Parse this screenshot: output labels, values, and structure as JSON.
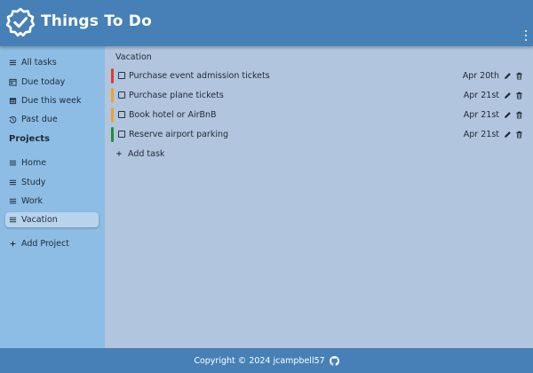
{
  "app": {
    "title": "Things To Do"
  },
  "colors": {
    "header": "#4680b7",
    "sidebar": "#8dbde5",
    "main": "#b1c5de",
    "active_item": "#b8d4ed",
    "priority_high": "#e23b2e",
    "priority_medium": "#f0a02c",
    "priority_low": "#21912f"
  },
  "sidebar": {
    "filters": [
      {
        "label": "All tasks",
        "icon": "list-icon"
      },
      {
        "label": "Due today",
        "icon": "calendar-today-icon"
      },
      {
        "label": "Due this week",
        "icon": "calendar-week-icon"
      },
      {
        "label": "Past due",
        "icon": "history-icon"
      }
    ],
    "projects_title": "Projects",
    "projects": [
      {
        "label": "Home",
        "icon": "list-icon"
      },
      {
        "label": "Study",
        "icon": "list-icon"
      },
      {
        "label": "Work",
        "icon": "list-icon"
      },
      {
        "label": "Vacation",
        "icon": "list-icon",
        "active": true
      }
    ],
    "add_project": "Add Project"
  },
  "main": {
    "title": "Vacation",
    "tasks": [
      {
        "name": "Purchase event admission tickets",
        "date": "Apr 20th",
        "priority": "high",
        "done": false
      },
      {
        "name": "Purchase plane tickets",
        "date": "Apr 21st",
        "priority": "medium",
        "done": false
      },
      {
        "name": "Book hotel or AirBnB",
        "date": "Apr 21st",
        "priority": "medium",
        "done": false
      },
      {
        "name": "Reserve airport parking",
        "date": "Apr 21st",
        "priority": "low",
        "done": false
      }
    ],
    "add_task": "Add task"
  },
  "footer": {
    "text": "Copyright © 2024 jcampbell57",
    "icon": "github-icon"
  }
}
